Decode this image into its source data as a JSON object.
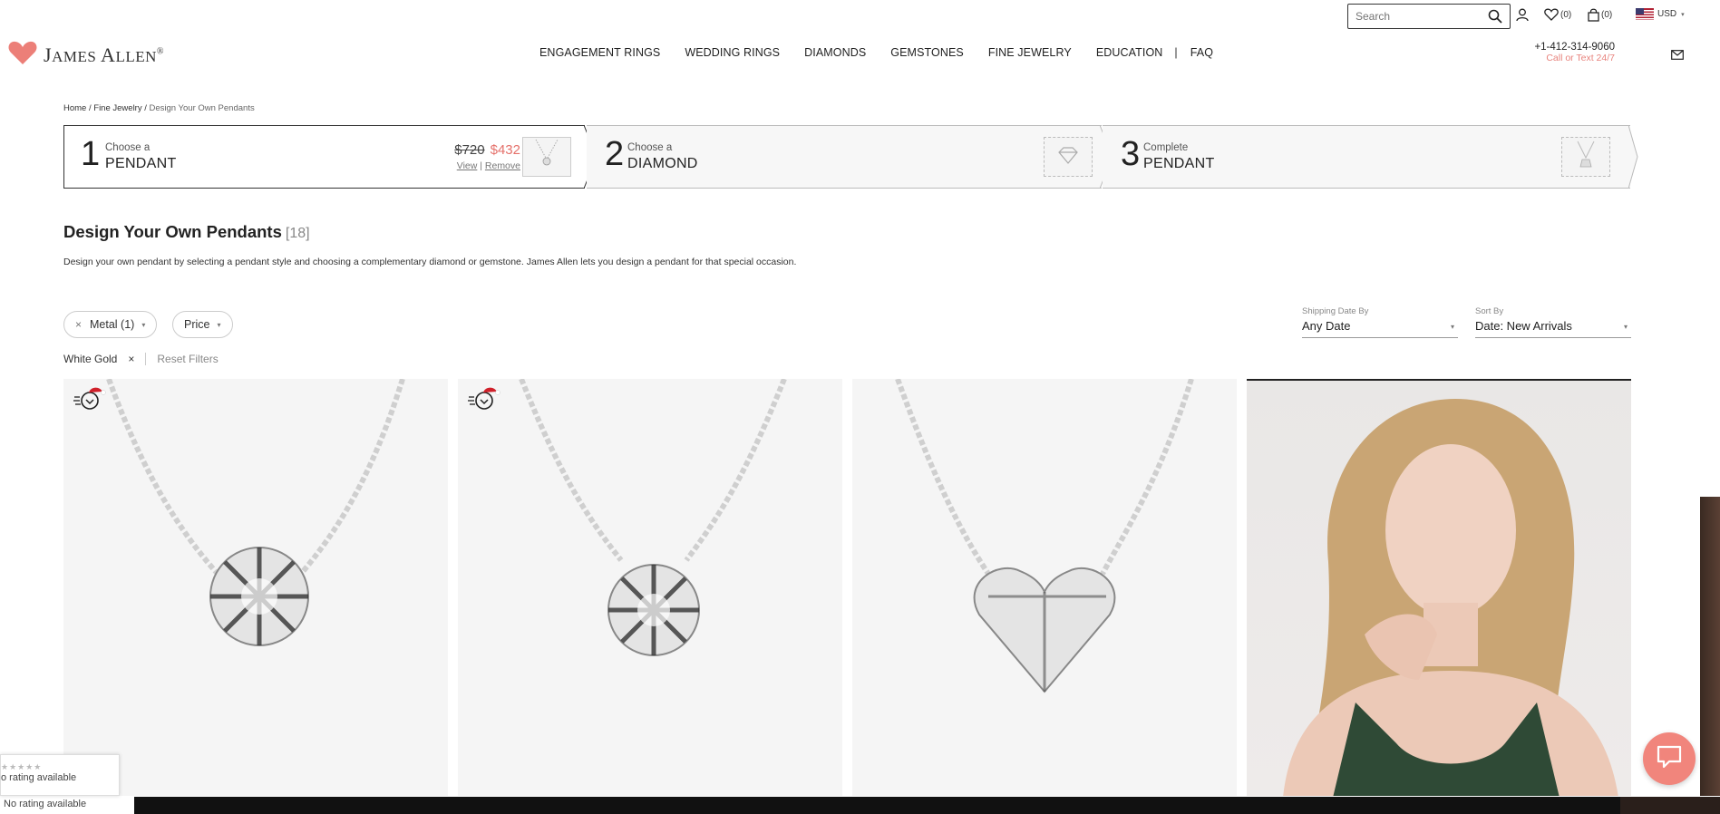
{
  "search": {
    "placeholder": "Search"
  },
  "utility": {
    "wishlist_count": "(0)",
    "cart_count": "(0)",
    "currency": "USD"
  },
  "brand": {
    "name_first": "J",
    "name_rest": "AMES ",
    "name_first2": "A",
    "name_rest2": "LLEN",
    "registered": "®"
  },
  "nav": {
    "items": [
      "ENGAGEMENT RINGS",
      "WEDDING RINGS",
      "DIAMONDS",
      "GEMSTONES",
      "FINE JEWELRY",
      "EDUCATION",
      "FAQ"
    ],
    "separator": "|"
  },
  "contact": {
    "phone": "+1-412-314-9060",
    "sub": "Call or Text 24/7"
  },
  "breadcrumb": {
    "home": "Home",
    "fine": "Fine Jewelry",
    "current": "Design Your Own Pendants",
    "sep": " / "
  },
  "steps": [
    {
      "num": "1",
      "label_small": "Choose a",
      "label_big": "PENDANT",
      "old_price": "$720",
      "new_price": "$432",
      "view": "View",
      "remove": "Remove",
      "link_sep": " | "
    },
    {
      "num": "2",
      "label_small": "Choose a",
      "label_big": "DIAMOND"
    },
    {
      "num": "3",
      "label_small": "Complete",
      "label_big": "PENDANT"
    }
  ],
  "page": {
    "title": "Design Your Own Pendants",
    "count": "[18]",
    "description": "Design your own pendant by selecting a pendant style and choosing a complementary diamond or gemstone. James Allen lets you design a pendant for that special occasion."
  },
  "filters": {
    "metal": "Metal (1)",
    "price": "Price",
    "applied": "White Gold",
    "reset": "Reset Filters",
    "remove_glyph": "×",
    "caret_glyph": "▾"
  },
  "shipping": {
    "label": "Shipping Date By",
    "value": "Any Date"
  },
  "sort": {
    "label": "Sort By",
    "value": "Date: New Arrivals"
  },
  "products": [
    {
      "shape": "round-solitaire",
      "badge": true
    },
    {
      "shape": "round-solitaire-small",
      "badge": true
    },
    {
      "shape": "heart",
      "badge": false
    },
    {
      "shape": "model-photo",
      "badge": false
    }
  ],
  "rating_widget": {
    "stars": "★★★★★",
    "text": "o rating available",
    "text2": "No rating available"
  },
  "colors": {
    "accent": "#e5716b",
    "chat": "#f1857c",
    "logo_heart": "#ec7f78"
  }
}
